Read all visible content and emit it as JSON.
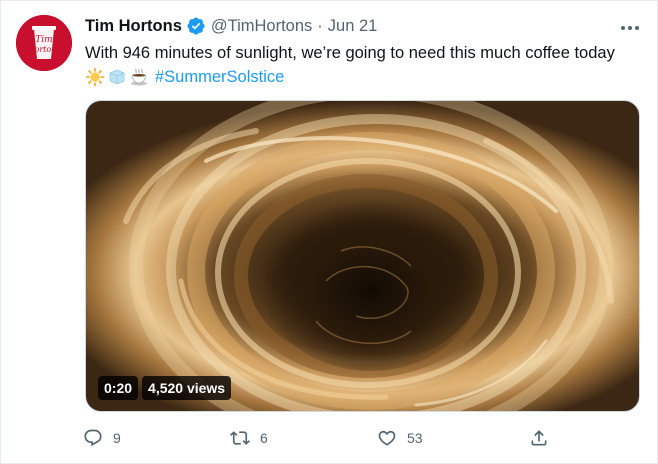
{
  "author": {
    "name": "Tim Hortons",
    "handle": "@TimHortons",
    "date": "Jun 21",
    "verified": true,
    "avatar_text": "Tim Hortons",
    "brand_color": "#c8102e"
  },
  "tweet": {
    "text": "With 946 minutes of sunlight, we’re going to need this much coffee today",
    "emojis": [
      "sun-emoji",
      "ice-cube-emoji",
      "hot-beverage-emoji"
    ],
    "hashtag": "#SummerSolstice",
    "link_color": "#1d9bf0"
  },
  "media": {
    "duration": "0:20",
    "views": "4,520 views"
  },
  "actions": {
    "replies": "9",
    "retweets": "6",
    "likes": "53"
  },
  "icons": [
    "verified-badge-icon",
    "more-icon",
    "reply-icon",
    "retweet-icon",
    "like-icon",
    "share-icon"
  ]
}
